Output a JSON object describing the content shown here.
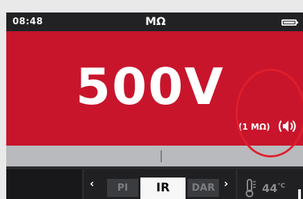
{
  "status_bar": {
    "time": "08:48",
    "unit": "MΩ",
    "battery_icon": "battery-full-icon"
  },
  "main_display": {
    "test_voltage": "500V",
    "resistance_range": "(1 MΩ)",
    "speaker_icon": "speaker-icon",
    "background_color": "#c8152c",
    "highlight_circle_color": "#e01e2b"
  },
  "mode_selector": {
    "prev_icon": "chevron-left-icon",
    "next_icon": "chevron-right-icon",
    "prev_mode_partial": "PI",
    "current_mode": "IR",
    "next_mode_partial": "DAR"
  },
  "temperature": {
    "icon": "thermometer-icon",
    "value": "44°C",
    "number": "44",
    "unit": "°C"
  }
}
